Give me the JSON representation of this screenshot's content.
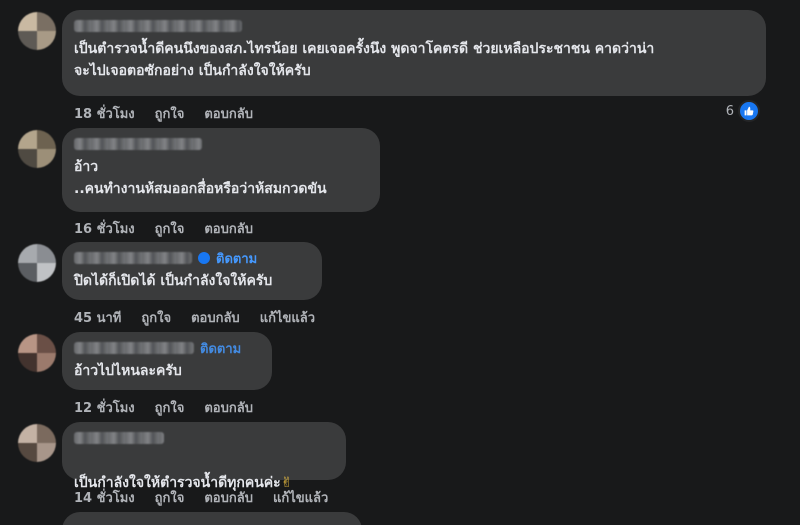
{
  "comments": [
    {
      "text": "เป็นตำรวจน้ำดีคนนึงของสภ.ไทรน้อย เคยเจอครั้งนึง พูดจาโคตรดี ช่วยเหลือประชาชน คาดว่าน่า\nจะไปเจอตอซักอย่าง เป็นกำลังใจให้ครับ",
      "time": "18 ชั่วโมง",
      "like_label": "ถูกใจ",
      "reply_label": "ตอบกลับ",
      "reaction_count": "6",
      "avatar_colors": [
        "#7a6f63",
        "#a89a86",
        "#5e5a55",
        "#c9b9a2"
      ]
    },
    {
      "text": "อ้าว\n..คนทำงานห้สมออกสื่อหรือว่าห้สมกวดขัน",
      "time": "16 ชั่วโมง",
      "like_label": "ถูกใจ",
      "reply_label": "ตอบกลับ",
      "avatar_colors": [
        "#6d6250",
        "#9c8f78",
        "#4f4a42",
        "#b3a58c"
      ]
    },
    {
      "follow_label": "ติดตาม",
      "text": "ปิดได้ก็เปิดได้ เป็นกำลังใจให้ครับ",
      "time": "45 นาที",
      "like_label": "ถูกใจ",
      "reply_label": "ตอบกลับ",
      "edit_label": "แก้ไขแล้ว",
      "avatar_colors": [
        "#8a8d92",
        "#c0c2c5",
        "#5b5e62",
        "#a7aaae"
      ]
    },
    {
      "follow_label": "ติดตาม",
      "text": "อ้าวไปไหนละครับ",
      "time": "12 ชั่วโมง",
      "like_label": "ถูกใจ",
      "reply_label": "ตอบกลับ",
      "avatar_colors": [
        "#6a4f46",
        "#9b7a6c",
        "#43332e",
        "#b89585"
      ]
    },
    {
      "text": "เป็นกำลังใจให้ตำรวจน้ำดีทุกคนค่ะ",
      "emoji": "✌",
      "time": "14 ชั่วโมง",
      "like_label": "ถูกใจ",
      "reply_label": "ตอบกลับ",
      "edit_label": "แก้ไขแล้ว",
      "avatar_colors": [
        "#7b6a5e",
        "#a8968a",
        "#564940",
        "#c4b2a4"
      ]
    }
  ],
  "icons": {
    "like": "thumbs-up-icon",
    "verified": "verified-badge-icon"
  }
}
